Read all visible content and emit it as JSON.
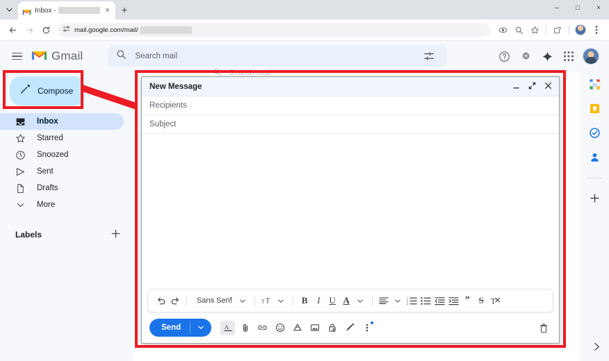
{
  "browser": {
    "tab": {
      "favicon": "gmail-icon",
      "title_prefix": "Inbox -",
      "redacted": true,
      "close": "×"
    },
    "new_tab_label": "+",
    "tabstrip_chevron": "⌄",
    "window_controls": {
      "minimize": "–",
      "maximize": "□",
      "close": "×"
    },
    "nav": {
      "back": "←",
      "forward": "→",
      "reload": "⟳"
    },
    "omnibox": {
      "site_settings_icon": "tune-icon",
      "url": "mail.google.com/mail/",
      "url_redacted": true
    },
    "toolbar_right": {
      "eye_icon": "eye-icon",
      "zoom_icon": "search-icon",
      "bookmark_icon": "star-icon",
      "extensions_icon": "extensions-icon",
      "profile_icon": "profile-avatar",
      "menu_icon": "kebab-menu-icon"
    }
  },
  "gmail": {
    "menu_label": "Main menu",
    "brand": "Gmail",
    "search": {
      "placeholder": "Search mail",
      "icon": "search-icon",
      "filter_icon": "tune-icon"
    },
    "header_icons": {
      "help": "help-icon",
      "settings": "gear-icon",
      "gemini": "sparkle-icon",
      "apps": "apps-grid-icon",
      "account": "account-avatar"
    }
  },
  "sidebar": {
    "compose": {
      "label": "Compose",
      "icon": "pencil-icon"
    },
    "items": [
      {
        "label": "Inbox",
        "icon": "inbox-icon",
        "active": true
      },
      {
        "label": "Starred",
        "icon": "star-icon",
        "active": false
      },
      {
        "label": "Snoozed",
        "icon": "clock-icon",
        "active": false
      },
      {
        "label": "Sent",
        "icon": "send-icon",
        "active": false
      },
      {
        "label": "Drafts",
        "icon": "file-icon",
        "active": false
      },
      {
        "label": "More",
        "icon": "chevron-down-icon",
        "active": false
      }
    ],
    "labels": {
      "title": "Labels",
      "add_icon": "plus-icon"
    }
  },
  "right_rail": {
    "items": [
      {
        "name": "calendar-icon",
        "glyph": "31"
      },
      {
        "name": "keep-icon",
        "glyph": ""
      },
      {
        "name": "tasks-icon",
        "glyph": ""
      },
      {
        "name": "contacts-icon",
        "glyph": ""
      }
    ],
    "add_label": "+",
    "expand_label": "›"
  },
  "compose": {
    "title": "New Message",
    "window_icons": {
      "minimize": "–",
      "popout": "pop-out-icon",
      "close": "×"
    },
    "recipients_placeholder": "Recipients",
    "subject_placeholder": "Subject",
    "body_value": "",
    "format_toolbar": {
      "undo": "undo-icon",
      "redo": "redo-icon",
      "font_family": "Sans Serif",
      "font_size_icon": "font-size-icon",
      "bold": "B",
      "italic": "I",
      "underline": "U",
      "text_color": "A",
      "align": "align-icon",
      "numbered_list": "numbered-list-icon",
      "bulleted_list": "bulleted-list-icon",
      "indent_less": "indent-less-icon",
      "indent_more": "indent-more-icon",
      "quote": "”",
      "strikethrough": "S",
      "remove_format": "remove-format-icon"
    },
    "send": {
      "label": "Send",
      "caret": "▾"
    },
    "send_icons": [
      {
        "name": "formatting-options-icon",
        "glyph": "A",
        "boxed": true
      },
      {
        "name": "attach-file-icon",
        "glyph": "attach"
      },
      {
        "name": "insert-link-icon",
        "glyph": "link"
      },
      {
        "name": "insert-emoji-icon",
        "glyph": "emoji"
      },
      {
        "name": "insert-drive-icon",
        "glyph": "drive"
      },
      {
        "name": "insert-photo-icon",
        "glyph": "photo"
      },
      {
        "name": "confidential-mode-icon",
        "glyph": "lock"
      },
      {
        "name": "insert-signature-icon",
        "glyph": "pen"
      },
      {
        "name": "more-options-icon",
        "glyph": "⋮"
      }
    ],
    "discard_icon": "trash-icon"
  },
  "annotations": {
    "highlight_color": "#ec1c24",
    "boxes": [
      "compose-button",
      "compose-window"
    ],
    "arrow": "compose-button-to-compose-window"
  },
  "colors": {
    "gmail_bg": "#f6f8fc",
    "accent_blue": "#1a73e8",
    "compose_btn": "#c2e7ff",
    "active_nav": "#d3e3fd",
    "annotation_red": "#ec1c24"
  }
}
